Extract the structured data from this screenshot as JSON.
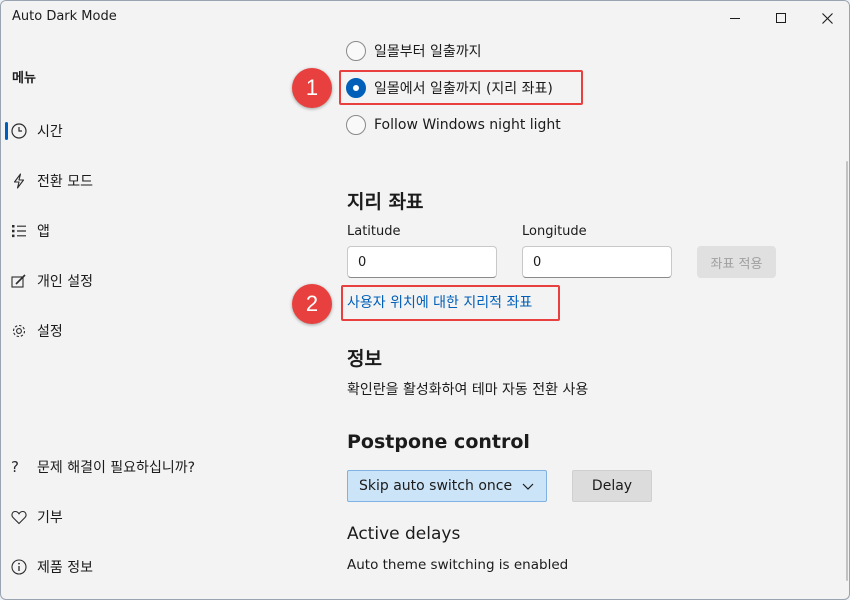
{
  "window": {
    "title": "Auto Dark Mode"
  },
  "sidebar": {
    "header": "메뉴",
    "items": [
      {
        "label": "시간",
        "icon": "clock-icon",
        "active": true
      },
      {
        "label": "전환 모드",
        "icon": "lightning-icon"
      },
      {
        "label": "앱",
        "icon": "list-icon"
      },
      {
        "label": "개인 설정",
        "icon": "paint-icon"
      },
      {
        "label": "설정",
        "icon": "gear-icon"
      }
    ],
    "bottom_items": [
      {
        "label": "문제 해결이 필요하십니까?",
        "icon": "question-icon"
      },
      {
        "label": "기부",
        "icon": "heart-icon"
      },
      {
        "label": "제품 정보",
        "icon": "info-icon"
      }
    ]
  },
  "radios": {
    "sunset_to_sunrise": "일몰부터 일출까지",
    "sunset_to_sunrise_geo": "일몰에서 일출까지 (지리 좌표)",
    "follow_windows": "Follow Windows night light",
    "selected": "sunset_to_sunrise_geo"
  },
  "geo": {
    "title": "지리 좌표",
    "latitude_label": "Latitude",
    "latitude_value": "0",
    "longitude_label": "Longitude",
    "longitude_value": "0",
    "apply_button": "좌표 적용",
    "link": "사용자 위치에 대한 지리적 좌표"
  },
  "info": {
    "title": "정보",
    "text": "확인란을 활성화하여 테마 자동 전환 사용"
  },
  "postpone": {
    "title": "Postpone control",
    "dropdown_value": "Skip auto switch once",
    "delay_button": "Delay",
    "active_delays_title": "Active delays",
    "status_text": "Auto theme switching is enabled"
  },
  "callouts": {
    "one": "1",
    "two": "2"
  },
  "colors": {
    "accent": "#005fb8",
    "callout": "#e8403e"
  }
}
